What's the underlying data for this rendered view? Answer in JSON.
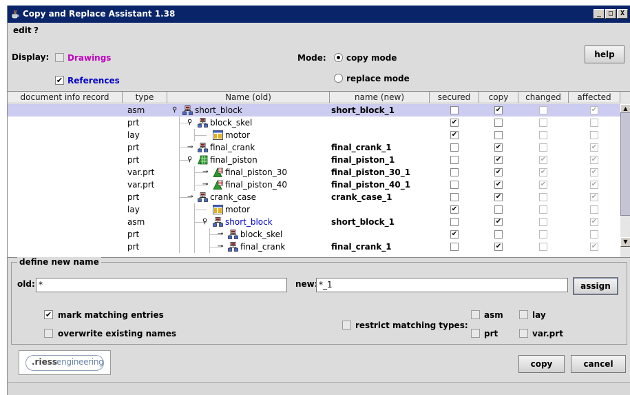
{
  "window": {
    "title": "Copy and Replace Assistant 1.38",
    "min": "_",
    "max": "□",
    "close": "X"
  },
  "menu": [
    "edit",
    "?"
  ],
  "display": {
    "label": "Display:",
    "drawings": {
      "label": "Drawings",
      "checked": false,
      "color": "#c000c0"
    },
    "references": {
      "label": "References",
      "checked": true,
      "color": "#0000cc"
    }
  },
  "mode": {
    "label": "Mode:",
    "copy": "copy mode",
    "replace": "replace mode",
    "selected": "copy"
  },
  "help_label": "help",
  "table": {
    "columns": [
      "document info record",
      "type",
      "Name (old)",
      "name (new)",
      "secured",
      "copy",
      "changed",
      "affected"
    ],
    "rows": [
      {
        "type": "asm",
        "name": "short_block",
        "new": "short_block_1",
        "secured": false,
        "copy": true,
        "changed": false,
        "affected": true,
        "depth": 0,
        "icon": "assembly-icon",
        "selected": true
      },
      {
        "type": "prt",
        "name": "block_skel",
        "new": "",
        "secured": true,
        "copy": false,
        "changed": false,
        "affected": false,
        "depth": 1,
        "icon": "assembly-icon"
      },
      {
        "type": "lay",
        "name": "motor",
        "new": "",
        "secured": true,
        "copy": false,
        "changed": false,
        "affected": false,
        "depth": 2,
        "icon": "layout-icon"
      },
      {
        "type": "prt",
        "name": "final_crank",
        "new": "final_crank_1",
        "secured": false,
        "copy": true,
        "changed": false,
        "affected": true,
        "depth": 1,
        "icon": "assembly-icon"
      },
      {
        "type": "prt",
        "name": "final_piston",
        "new": "final_piston_1",
        "secured": false,
        "copy": true,
        "changed": true,
        "affected": true,
        "depth": 1,
        "icon": "family-table-icon"
      },
      {
        "type": "var.prt",
        "name": "final_piston_30",
        "new": "final_piston_30_1",
        "secured": false,
        "copy": true,
        "changed": true,
        "affected": true,
        "depth": 2,
        "icon": "variant-icon"
      },
      {
        "type": "var.prt",
        "name": "final_piston_40",
        "new": "final_piston_40_1",
        "secured": false,
        "copy": true,
        "changed": true,
        "affected": true,
        "depth": 2,
        "icon": "variant-icon"
      },
      {
        "type": "prt",
        "name": "crank_case",
        "new": "crank_case_1",
        "secured": false,
        "copy": true,
        "changed": false,
        "affected": true,
        "depth": 1,
        "icon": "assembly-icon"
      },
      {
        "type": "lay",
        "name": "motor",
        "new": "",
        "secured": true,
        "copy": false,
        "changed": false,
        "affected": false,
        "depth": 2,
        "icon": "layout-icon"
      },
      {
        "type": "asm",
        "name": "short_block",
        "new": "short_block_1",
        "secured": false,
        "copy": true,
        "changed": false,
        "affected": true,
        "depth": 2,
        "icon": "assembly-icon",
        "link": true
      },
      {
        "type": "prt",
        "name": "block_skel",
        "new": "",
        "secured": true,
        "copy": false,
        "changed": false,
        "affected": false,
        "depth": 3,
        "icon": "assembly-icon"
      },
      {
        "type": "prt",
        "name": "final_crank",
        "new": "final_crank_1",
        "secured": false,
        "copy": true,
        "changed": false,
        "affected": true,
        "depth": 3,
        "icon": "assembly-icon"
      }
    ]
  },
  "define": {
    "legend": "define new name",
    "old_label": "old:",
    "old_value": "*",
    "new_label": "new:",
    "new_value": "*_1",
    "assign": "assign",
    "mark_matching": {
      "label": "mark matching entries",
      "checked": true
    },
    "overwrite": {
      "label": "overwrite existing names",
      "checked": false
    },
    "restrict": {
      "label": "restrict matching types:",
      "checked": false
    },
    "types": [
      {
        "label": "asm",
        "checked": false
      },
      {
        "label": "lay",
        "checked": false
      },
      {
        "label": "prt",
        "checked": false
      },
      {
        "label": "var.prt",
        "checked": false
      }
    ]
  },
  "logo": {
    "dot_prefix": ".riess",
    "suffix": "engineering"
  },
  "buttons": {
    "copy": "copy",
    "cancel": "cancel"
  },
  "colors": {
    "titlebar": "#0a246a",
    "selected_row": "#ccccf0",
    "link": "#0000cc"
  }
}
